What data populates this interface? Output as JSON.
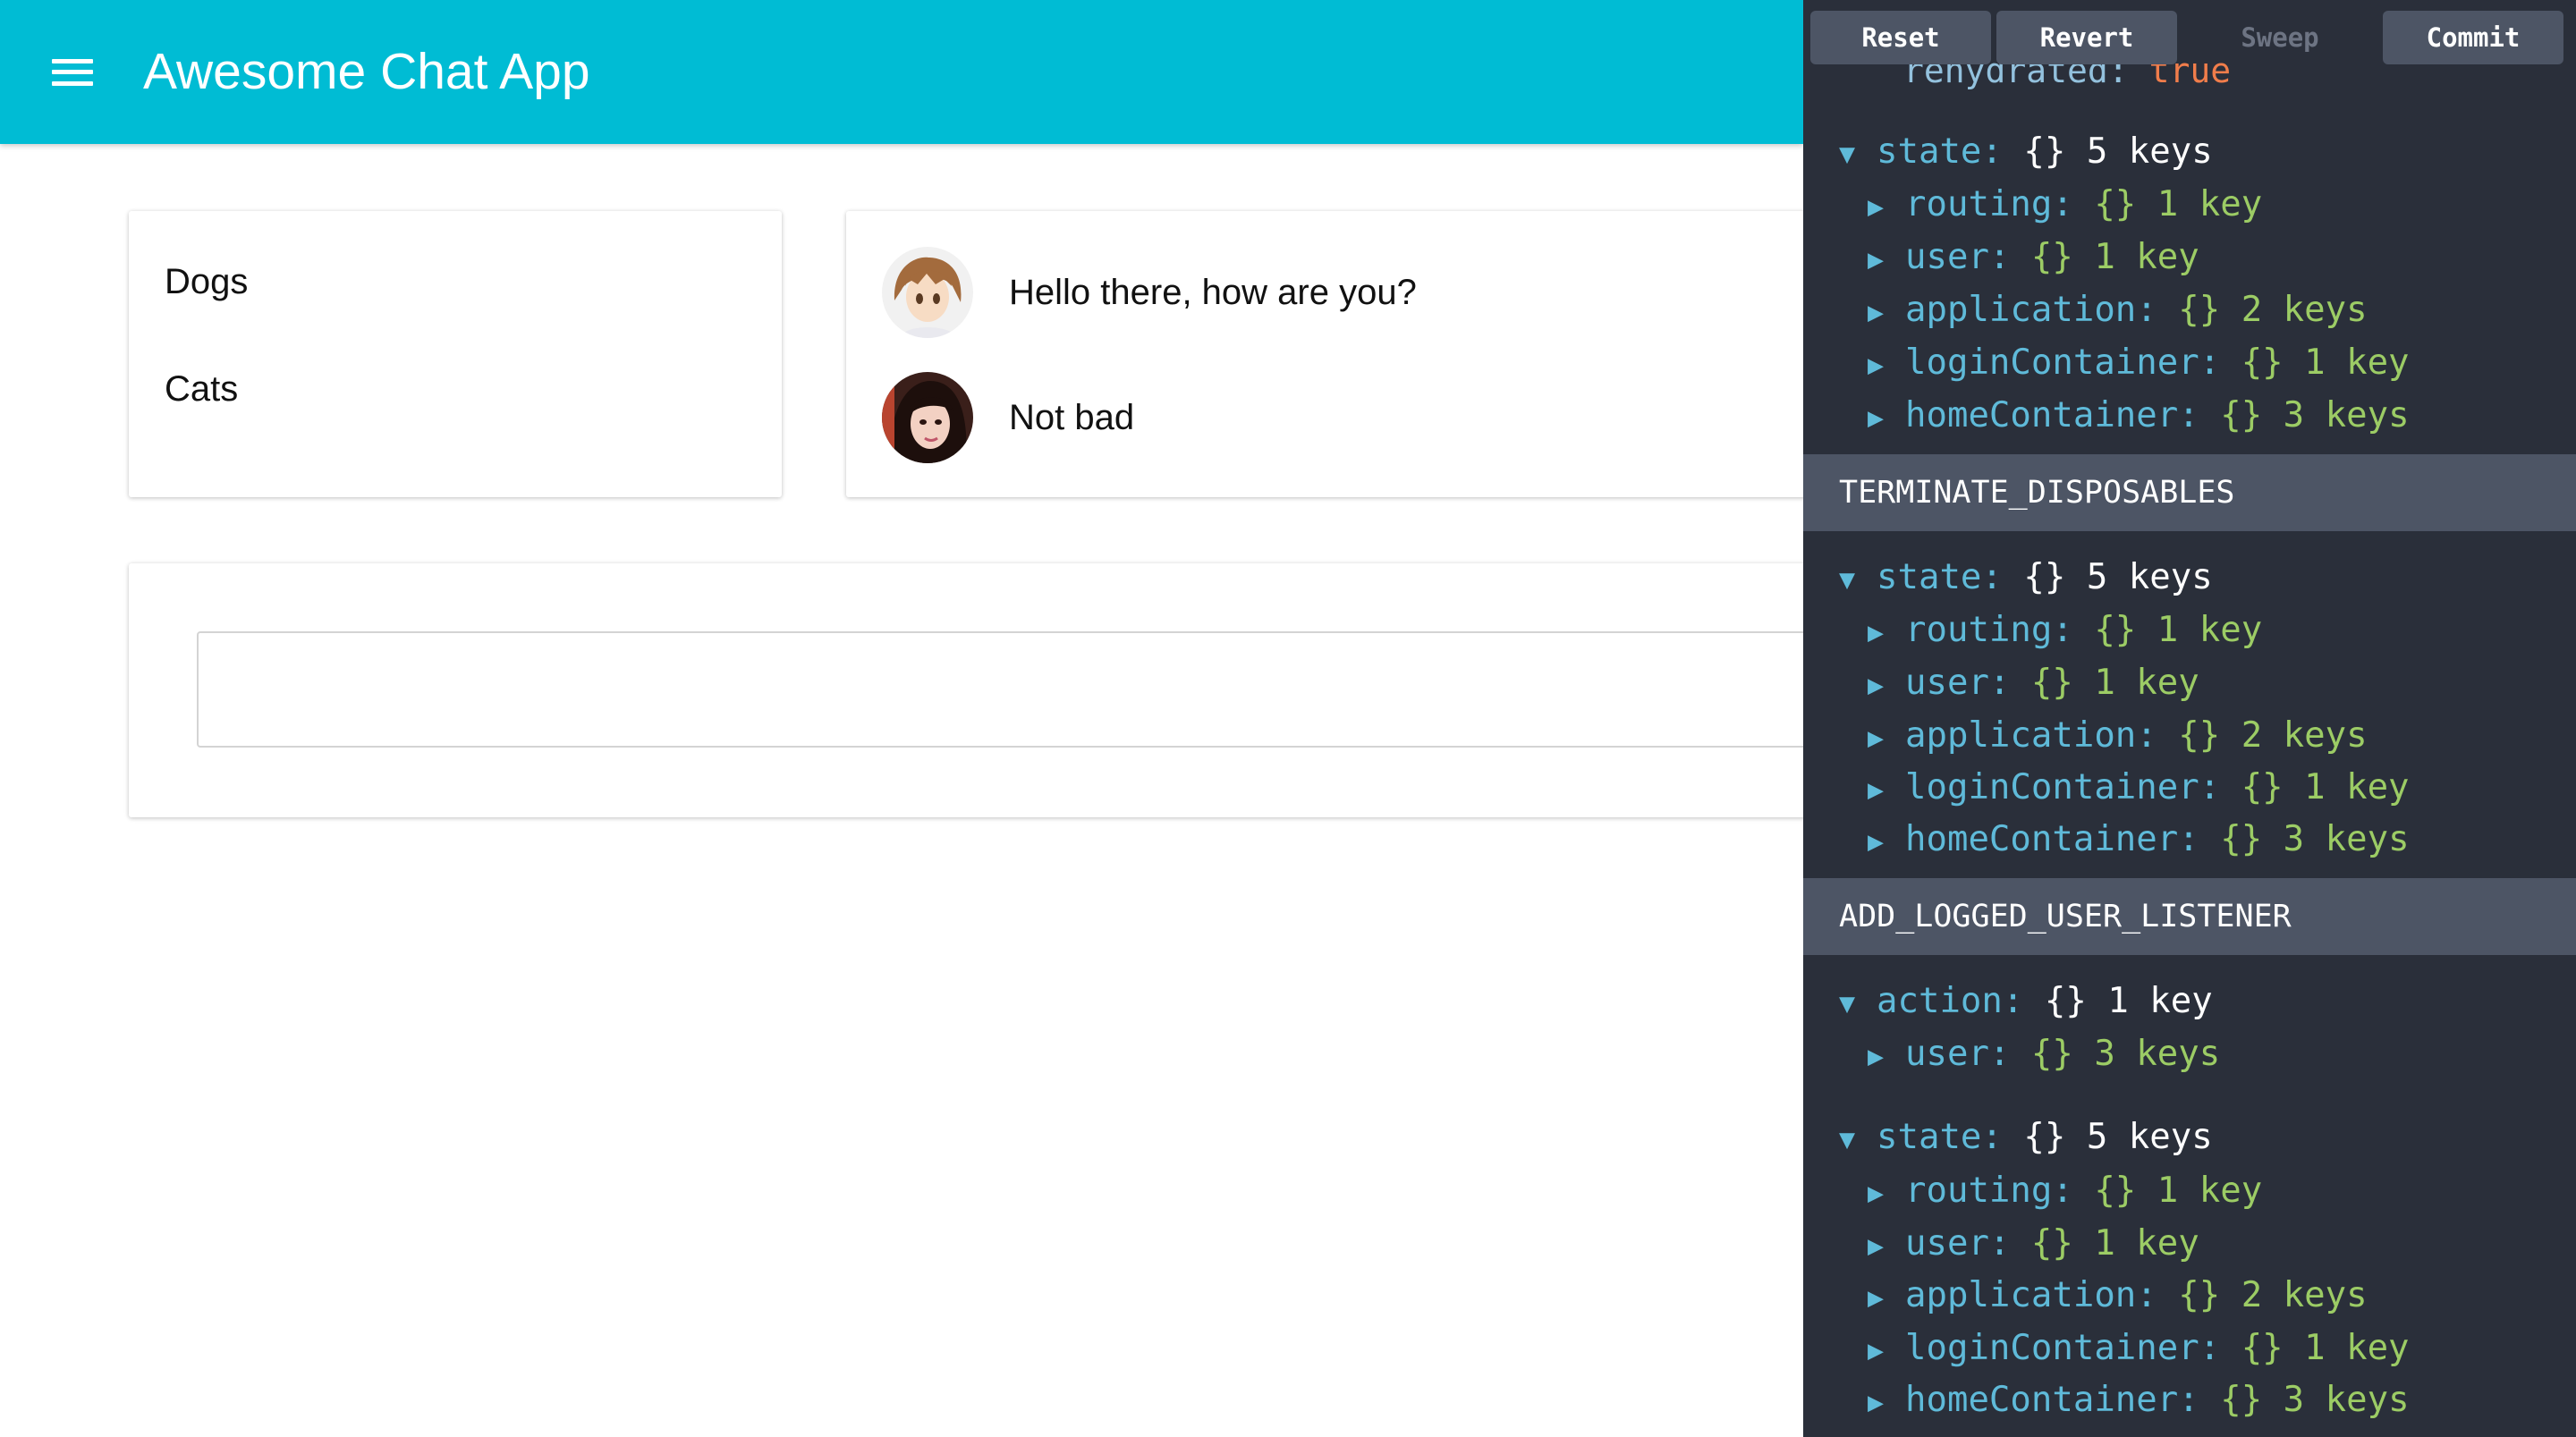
{
  "app": {
    "title": "Awesome Chat App",
    "menu_icon": "hamburger-menu-icon",
    "bar_color": "#00bcd4"
  },
  "channels": [
    {
      "label": "Dogs"
    },
    {
      "label": "Cats"
    }
  ],
  "messages": [
    {
      "text": "Hello there, how are you?",
      "avatar": "anime-boy-avatar"
    },
    {
      "text": "Not bad",
      "avatar": "woman-photo-avatar"
    }
  ],
  "composer": {
    "value": "",
    "placeholder": ""
  },
  "devtools": {
    "buttons": {
      "reset": "Reset",
      "revert": "Revert",
      "sweep": "Sweep",
      "commit": "Commit"
    },
    "clipped_line": {
      "key": "rehydrated:",
      "value": "true"
    },
    "blocks": [
      {
        "root": {
          "key": "state:",
          "braces": "{}",
          "count": "5 keys"
        },
        "children": [
          {
            "key": "routing:",
            "braces": "{}",
            "count": "1 key"
          },
          {
            "key": "user:",
            "braces": "{}",
            "count": "1 key"
          },
          {
            "key": "application:",
            "braces": "{}",
            "count": "2 keys"
          },
          {
            "key": "loginContainer:",
            "braces": "{}",
            "count": "1 key"
          },
          {
            "key": "homeContainer:",
            "braces": "{}",
            "count": "3 keys"
          }
        ]
      },
      {
        "header": "TERMINATE_DISPOSABLES",
        "root": {
          "key": "state:",
          "braces": "{}",
          "count": "5 keys"
        },
        "children": [
          {
            "key": "routing:",
            "braces": "{}",
            "count": "1 key"
          },
          {
            "key": "user:",
            "braces": "{}",
            "count": "1 key"
          },
          {
            "key": "application:",
            "braces": "{}",
            "count": "2 keys"
          },
          {
            "key": "loginContainer:",
            "braces": "{}",
            "count": "1 key"
          },
          {
            "key": "homeContainer:",
            "braces": "{}",
            "count": "3 keys"
          }
        ]
      },
      {
        "header": "ADD_LOGGED_USER_LISTENER",
        "action": {
          "root": {
            "key": "action:",
            "braces": "{}",
            "count": "1 key"
          },
          "children": [
            {
              "key": "user:",
              "braces": "{}",
              "count": "3 keys"
            }
          ]
        },
        "root": {
          "key": "state:",
          "braces": "{}",
          "count": "5 keys"
        },
        "children": [
          {
            "key": "routing:",
            "braces": "{}",
            "count": "1 key"
          },
          {
            "key": "user:",
            "braces": "{}",
            "count": "1 key"
          },
          {
            "key": "application:",
            "braces": "{}",
            "count": "2 keys"
          },
          {
            "key": "loginContainer:",
            "braces": "{}",
            "count": "1 key"
          },
          {
            "key": "homeContainer:",
            "braces": "{}",
            "count": "3 keys"
          }
        ]
      }
    ]
  }
}
